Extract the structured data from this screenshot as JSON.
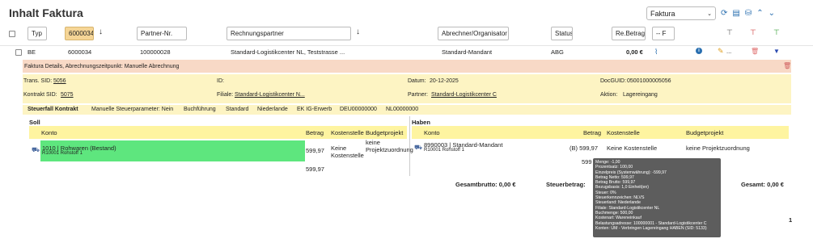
{
  "page": {
    "title": "Inhalt Faktura"
  },
  "toolbar": {
    "select_value": "Faktura"
  },
  "header": {
    "col_typ": "Typ",
    "col_id_value": "6000034",
    "col_partner_nr": "Partner-Nr.",
    "col_rechnungspartner": "Rechnungspartner",
    "col_abrechner": "Abrechner/Organisator",
    "col_status": "Status",
    "col_betrag": "Re.Betrag",
    "col_filter_select": "-- F"
  },
  "row": {
    "typ": "BE",
    "id": "6000034",
    "partner_nr": "100000028",
    "rechnungspartner": "Standard-Logistikcenter NL, Teststrasse ...",
    "abrechner": "Standard-Mandant",
    "status": "ABG",
    "betrag": "0,00 €",
    "ellipsis": "..."
  },
  "detail": {
    "header": "Faktura Details, Abrechnungszeitpunkt: Manuelle Abrechnung",
    "trans_sid_label": "Trans. SID:",
    "trans_sid_value": "5056",
    "id_label": "ID:",
    "datum_label": "Datum:",
    "datum_value": "20-12-2025",
    "docguid_label": "DocGUID:",
    "docguid_value": "05001000005056",
    "kontrakt_label": "Kontrakt SID:",
    "kontrakt_value": "5075",
    "filiale_label": "Filiale:",
    "filiale_value": "Standard-Logistikcenter N...",
    "partner_label": "Partner:",
    "partner_value": "Standard-Logistikcenter C",
    "aktion_label": "Aktion:",
    "aktion_value": "Lagereingang",
    "tax_title": "Steuerfall Kontrakt",
    "tax_items": [
      "Manuelle Steuerparameter: Nein",
      "Buchführung",
      "Standard",
      "Niederlande",
      "EK IG-Erwerb",
      "DEU00000000",
      "NL00000000"
    ]
  },
  "soll": {
    "title": "Soll",
    "col_konto": "Konto",
    "col_betrag": "Betrag",
    "col_kostenstelle": "Kostenstelle",
    "col_budget": "Budgetprojekt",
    "konto_line1": "1010 | Rohwaren (Bestand)",
    "konto_line2": "R10001 Rohstoff 1",
    "betrag": "599,97",
    "kostenstelle": "Keine Kostenstelle",
    "budget": "keine Projektzuordnung",
    "sum": "599,97",
    "gesamtbrutto": "Gesamtbrutto: 0,00 €"
  },
  "haben": {
    "title": "Haben",
    "col_konto": "Konto",
    "col_betrag": "Betrag",
    "col_kostenstelle": "Kostenstelle",
    "col_budget": "Budgetprojekt",
    "konto_line1": "8990003 | Standard-Mandant",
    "konto_line2": "R10001 Rohstoff 1",
    "betrag": "(B) 599,97",
    "kostenstelle": "Keine Kostenstelle",
    "budget": "keine Projektzuordnung",
    "sum_partial": "599",
    "steuerbetrag": "Steuerbetrag:",
    "gesamt": "Gesamt: 0,00 €"
  },
  "tooltip": {
    "lines": [
      "Menge: -1,00",
      "Prozentsatz: 100,00",
      "Einzelpreis (Systemwährung): -599,97",
      "Betrag Netto: 599,97",
      "Betrag Brutto: 599,97",
      "Bezugsbasis: 1,0 Einheit(en)",
      "Steuer: 0%",
      "Steuerkennzeichen: NLVS",
      "Steuerland: Niederlande",
      "Filiale: Standard-Logistikcenter NL",
      "Buchmenge: 500,00",
      "Kostenart: Wareneinkauf",
      "Belastungsadresse: 100000001 - Standard-Logistikcenter C",
      "Konten: UM - Verbringen Lagereingang HABEN (SID: 5133)"
    ]
  },
  "pagination": {
    "page": "1"
  },
  "colors": {
    "accent": "#2a6fb0",
    "detail_bg": "#f8d9c6",
    "yellow": "#fdf4c3",
    "header_yellow": "#fef4a0",
    "green": "#5ee67e",
    "tooltip": "#5d5d5d"
  }
}
